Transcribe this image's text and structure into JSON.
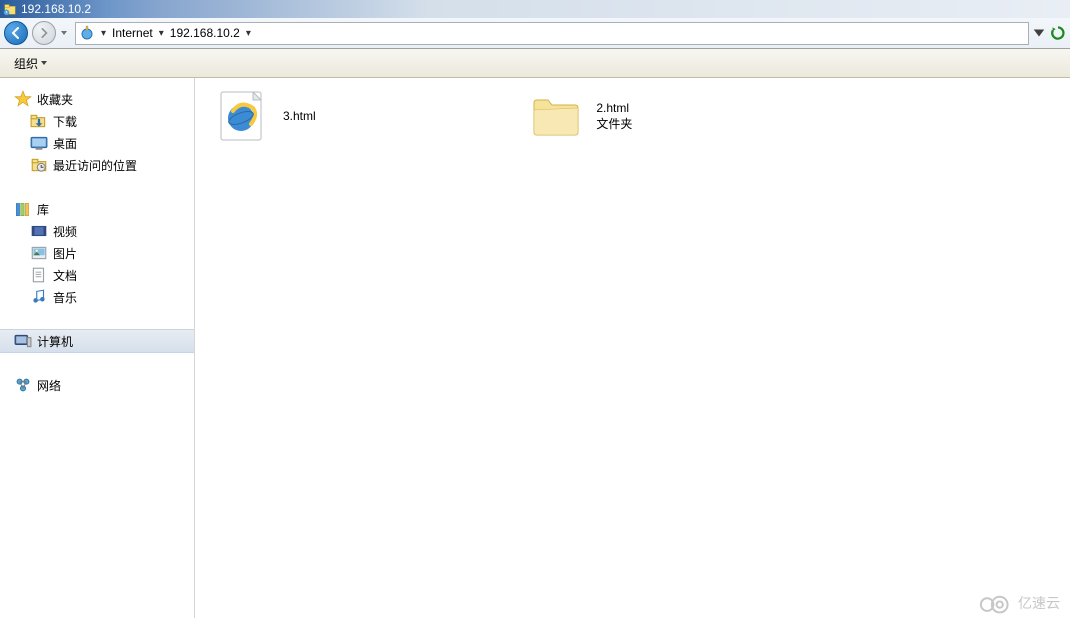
{
  "titlebar": {
    "title": "192.168.10.2"
  },
  "breadcrumb": {
    "seg1": "Internet",
    "seg2": "192.168.10.2"
  },
  "toolbar": {
    "organize": "组织"
  },
  "sidebar": {
    "favorites": {
      "header": "收藏夹",
      "downloads": "下载",
      "desktop": "桌面",
      "recent": "最近访问的位置"
    },
    "libraries": {
      "header": "库",
      "videos": "视频",
      "pictures": "图片",
      "documents": "文档",
      "music": "音乐"
    },
    "computer": "计算机",
    "network": "网络"
  },
  "files": [
    {
      "name": "3.html",
      "sub": ""
    },
    {
      "name": "2.html",
      "sub": "文件夹"
    }
  ],
  "watermark": "亿速云"
}
